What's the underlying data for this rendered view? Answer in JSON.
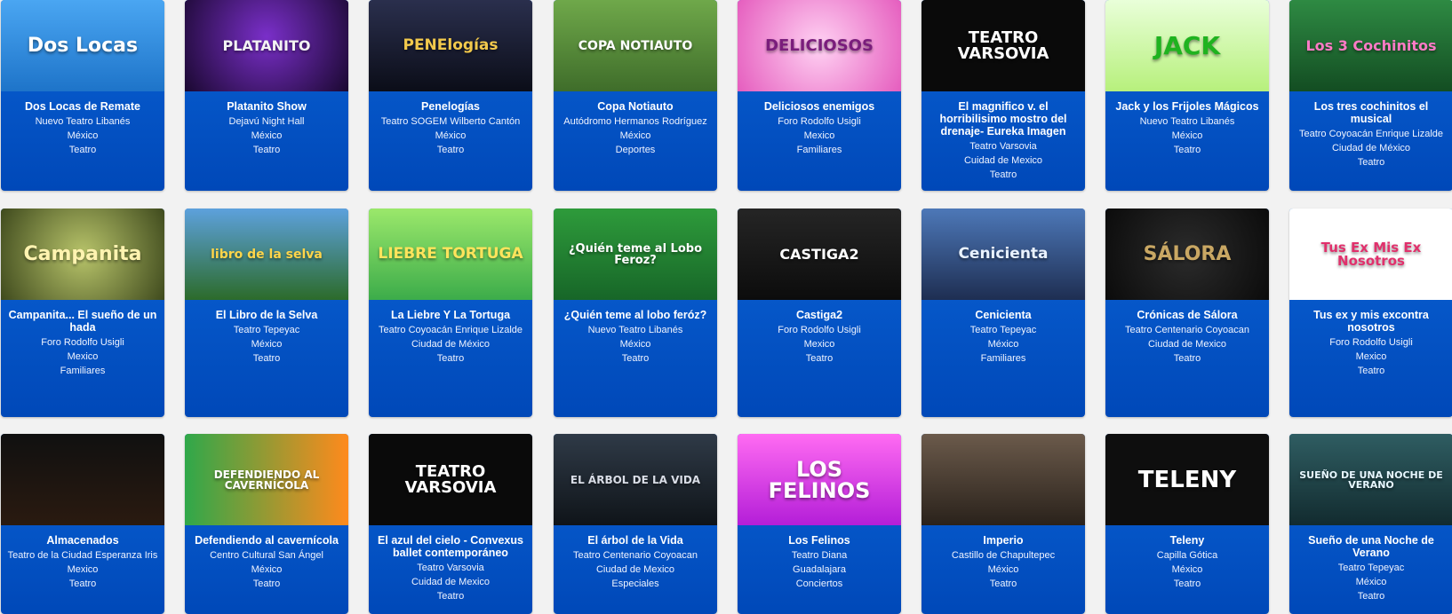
{
  "events": [
    {
      "title": "Dos Locas de Remate",
      "venue": "Nuevo Teatro Libanés",
      "place": "México",
      "category": "Teatro",
      "poster_text": "Dos Locas",
      "poster_bg": "linear-gradient(#4aa6f2,#1e74c9)",
      "poster_fg": "#ffffff",
      "poster_size": "22px"
    },
    {
      "title": "Platanito Show",
      "venue": "Dejavú Night Hall",
      "place": "México",
      "category": "Teatro",
      "poster_text": "PLATANITO",
      "poster_bg": "radial-gradient(circle at 50% 40%,#7a2fc9,#1a0830)",
      "poster_fg": "#f3f3f3",
      "poster_size": "16px"
    },
    {
      "title": "Penelogías",
      "venue": "Teatro SOGEM Wilberto Cantón",
      "place": "México",
      "category": "Teatro",
      "poster_text": "PENElogías",
      "poster_bg": "linear-gradient(#2a2f4d,#0b0d18)",
      "poster_fg": "#f2c94c",
      "poster_size": "17px"
    },
    {
      "title": "Copa Notiauto",
      "venue": "Autódromo Hermanos Rodríguez",
      "place": "México",
      "category": "Deportes",
      "poster_text": "COPA NOTIAUTO",
      "poster_bg": "linear-gradient(#6fa84a,#3f6d2a)",
      "poster_fg": "#ffffff",
      "poster_size": "14px"
    },
    {
      "title": "Deliciosos enemigos",
      "venue": "Foro Rodolfo Usigli",
      "place": "Mexico",
      "category": "Familiares",
      "poster_text": "DELICIOSOS",
      "poster_bg": "radial-gradient(circle,#ffd2f3,#e55dbe)",
      "poster_fg": "#7a1d7c",
      "poster_size": "18px"
    },
    {
      "title": "El magnifico v. el horribilisimo mostro del drenaje- Eureka Imagen",
      "venue": "Teatro Varsovia",
      "place": "Cuidad de Mexico",
      "category": "Teatro",
      "poster_text": "TEATRO VARSOVIA",
      "poster_bg": "#0a0a0a",
      "poster_fg": "#ffffff",
      "poster_size": "18px"
    },
    {
      "title": "Jack y los Frijoles Mágicos",
      "venue": "Nuevo Teatro Libanés",
      "place": "México",
      "category": "Teatro",
      "poster_text": "JACK",
      "poster_bg": "linear-gradient(#e9ffd9,#b7f07c)",
      "poster_fg": "#1fb31f",
      "poster_size": "28px"
    },
    {
      "title": "Los tres cochinitos el musical",
      "venue": "Teatro Coyoacán Enrique Lizalde",
      "place": "Ciudad de México",
      "category": "Teatro",
      "poster_text": "Los 3 Cochinitos",
      "poster_bg": "linear-gradient(#2e8a43,#134d22)",
      "poster_fg": "#ff7bc6",
      "poster_size": "16px"
    },
    {
      "title": "Campanita... El sueño de un hada",
      "venue": "Foro Rodolfo Usigli",
      "place": "Mexico",
      "category": "Familiares",
      "poster_text": "Campanita",
      "poster_bg": "radial-gradient(circle,#b8c46a,#3f4a1d)",
      "poster_fg": "#fff3b0",
      "poster_size": "22px"
    },
    {
      "title": "El Libro de la Selva",
      "venue": "Teatro Tepeyac",
      "place": "México",
      "category": "Teatro",
      "poster_text": "libro de la selva",
      "poster_bg": "linear-gradient(#5da1dd,#2c6b2a)",
      "poster_fg": "#ffd54a",
      "poster_size": "14px"
    },
    {
      "title": "La Liebre Y La Tortuga",
      "venue": "Teatro Coyoacán Enrique Lizalde",
      "place": "Ciudad de México",
      "category": "Teatro",
      "poster_text": "LIEBRE TORTUGA",
      "poster_bg": "linear-gradient(#9be86b,#3cac4a)",
      "poster_fg": "#ffe45c",
      "poster_size": "17px"
    },
    {
      "title": "¿Quién teme al lobo feróz?",
      "venue": "Nuevo Teatro Libanés",
      "place": "México",
      "category": "Teatro",
      "poster_text": "¿Quién teme al Lobo Feroz?",
      "poster_bg": "linear-gradient(#2e9b3b,#176628)",
      "poster_fg": "#ffffff",
      "poster_size": "13px"
    },
    {
      "title": "Castiga2",
      "venue": "Foro Rodolfo Usigli",
      "place": "Mexico",
      "category": "Teatro",
      "poster_text": "CASTIGA2",
      "poster_bg": "linear-gradient(#252525,#0c0c0c)",
      "poster_fg": "#ffffff",
      "poster_size": "16px"
    },
    {
      "title": "Cenicienta",
      "venue": "Teatro Tepeyac",
      "place": "México",
      "category": "Familiares",
      "poster_text": "Cenicienta",
      "poster_bg": "linear-gradient(#4d78b8,#1e2e52)",
      "poster_fg": "#e9f2ff",
      "poster_size": "17px"
    },
    {
      "title": "Crónicas de Sálora",
      "venue": "Teatro Centenario Coyoacan",
      "place": "Ciudad de Mexico",
      "category": "Teatro",
      "poster_text": "SÁLORA",
      "poster_bg": "radial-gradient(circle,#2b2b2b,#0b0b0b)",
      "poster_fg": "#c9a763",
      "poster_size": "22px"
    },
    {
      "title": "Tus ex y mis excontra nosotros",
      "venue": "Foro Rodolfo Usigli",
      "place": "Mexico",
      "category": "Teatro",
      "poster_text": "Tus Ex Mis Ex Nosotros",
      "poster_bg": "#ffffff",
      "poster_fg": "#e1306c",
      "poster_size": "15px"
    },
    {
      "title": "Almacenados",
      "venue": "Teatro de la Ciudad Esperanza Iris",
      "place": "Mexico",
      "category": "Teatro",
      "poster_text": "",
      "poster_bg": "linear-gradient(#101010,#2a1a10)",
      "poster_fg": "#ffffff",
      "poster_size": "12px"
    },
    {
      "title": "Defendiendo al cavernícola",
      "venue": "Centro Cultural San Ángel",
      "place": "México",
      "category": "Teatro",
      "poster_text": "DEFENDIENDO AL CAVERNÍCOLA",
      "poster_bg": "linear-gradient(90deg,#2fa84a,#ff8a1c)",
      "poster_fg": "#ffffff",
      "poster_size": "12px"
    },
    {
      "title": "El azul del cielo - Convexus ballet contemporáneo",
      "venue": "Teatro Varsovia",
      "place": "Cuidad de Mexico",
      "category": "Teatro",
      "poster_text": "TEATRO VARSOVIA",
      "poster_bg": "#0a0a0a",
      "poster_fg": "#ffffff",
      "poster_size": "18px"
    },
    {
      "title": "El árbol de la Vida",
      "venue": "Teatro Centenario Coyoacan",
      "place": "Ciudad de Mexico",
      "category": "Especiales",
      "poster_text": "EL ÁRBOL DE LA VIDA",
      "poster_bg": "linear-gradient(#2f3a47,#0f1419)",
      "poster_fg": "#d9dde6",
      "poster_size": "12px"
    },
    {
      "title": "Los Felinos",
      "venue": "Teatro Diana",
      "place": "Guadalajara",
      "category": "Conciertos",
      "poster_text": "LOS FELINOS",
      "poster_bg": "linear-gradient(#ff6bf2,#b41ed8)",
      "poster_fg": "#ffffff",
      "poster_size": "24px"
    },
    {
      "title": "Imperio",
      "venue": "Castillo de Chapultepec",
      "place": "México",
      "category": "Teatro",
      "poster_text": "",
      "poster_bg": "linear-gradient(#6b5a4b,#2a221b)",
      "poster_fg": "#ffffff",
      "poster_size": "12px"
    },
    {
      "title": "Teleny",
      "venue": "Capilla Gótica",
      "place": "México",
      "category": "Teatro",
      "poster_text": "TELENY",
      "poster_bg": "#0e0e0e",
      "poster_fg": "#ffffff",
      "poster_size": "26px"
    },
    {
      "title": "Sueño de una Noche de Verano",
      "venue": "Teatro Tepeyac",
      "place": "México",
      "category": "Teatro",
      "poster_text": "SUEÑO DE UNA NOCHE DE VERANO",
      "poster_bg": "linear-gradient(#2f5d62,#122b2f)",
      "poster_fg": "#e7f7ff",
      "poster_size": "11px"
    }
  ]
}
